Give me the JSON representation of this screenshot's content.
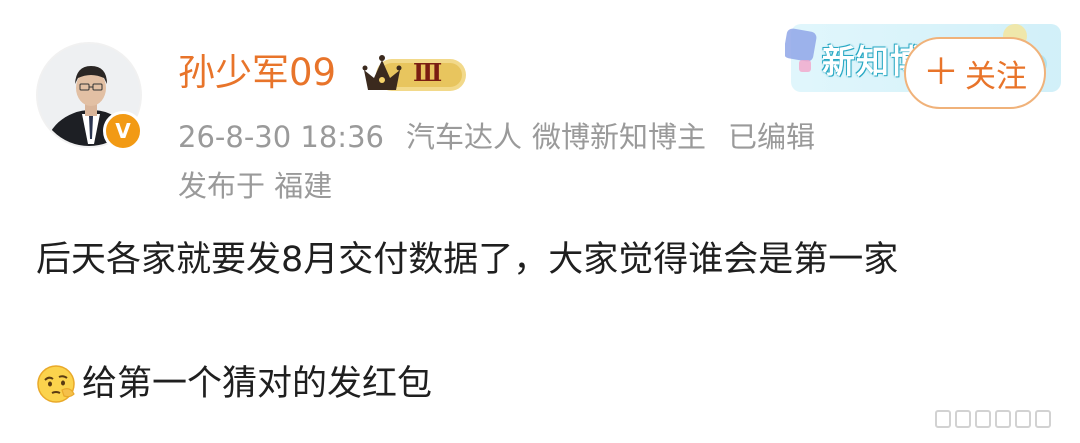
{
  "post": {
    "username": "孙少军09",
    "member_level": "Ⅲ",
    "verified_badge": "V",
    "date": "26-8-30 18:36",
    "tag_auto": "汽车达人",
    "tag_weibo": "微博新知博主",
    "edited": "已编辑",
    "location": "发布于 福建",
    "banner_text": "新知博",
    "follow_label": "关注",
    "content_line1": "后天各家就要发8月交付数据了，大家觉得谁会是第一家",
    "content_line2": "给第一个猜对的发红包"
  },
  "colors": {
    "username": "#e8742a",
    "meta": "#9a9a9a",
    "body_text": "#1f1f1f",
    "follow_border": "#f0b27a",
    "verified": "#f29a14"
  },
  "icons": [
    "avatar",
    "verified-badge-icon",
    "crown-badge-icon",
    "banner-icon",
    "plus-icon",
    "thinking-emoji-icon",
    "watermark-icon"
  ]
}
